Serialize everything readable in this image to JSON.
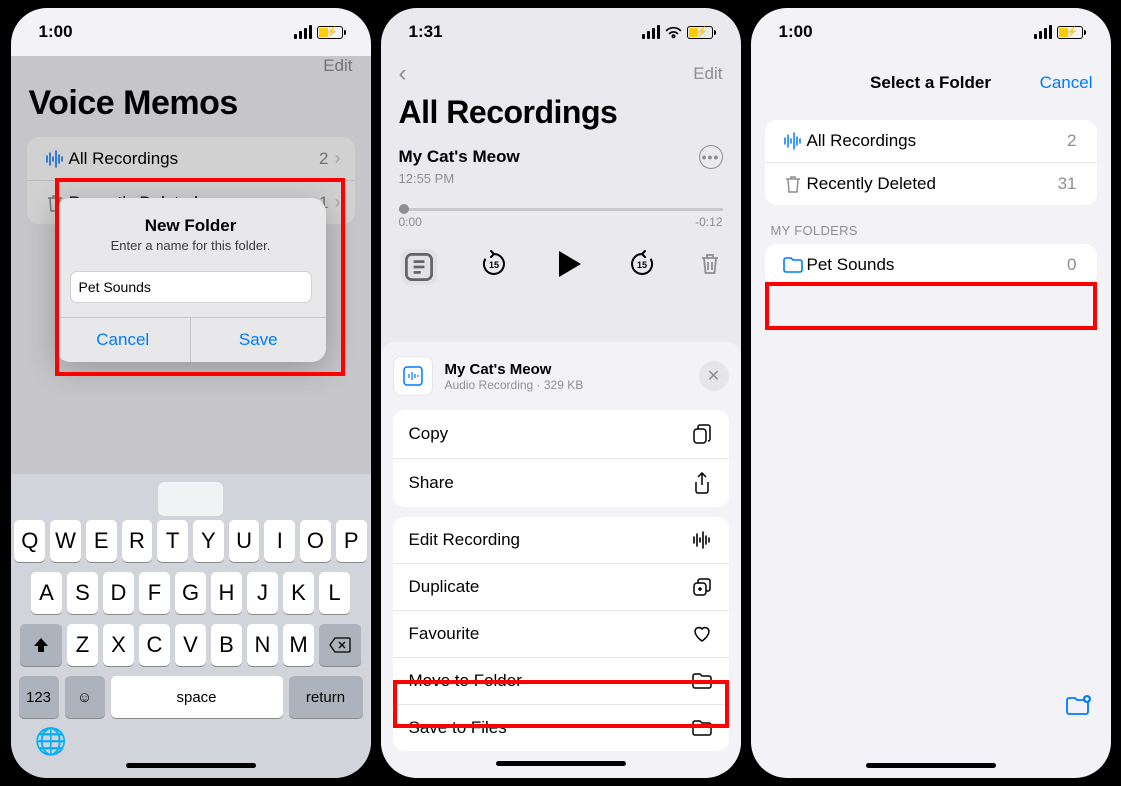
{
  "status": {
    "time1": "1:00",
    "time2": "1:31",
    "time3": "1:00"
  },
  "screen1": {
    "edit": "Edit",
    "title": "Voice Memos",
    "rows": [
      {
        "label": "All Recordings",
        "count": "2"
      },
      {
        "label": "Recently Deleted",
        "count": "1"
      }
    ],
    "alert": {
      "title": "New Folder",
      "message": "Enter a name for this folder.",
      "value": "Pet Sounds",
      "cancel": "Cancel",
      "save": "Save"
    },
    "keyboard": {
      "r1": [
        "Q",
        "W",
        "E",
        "R",
        "T",
        "Y",
        "U",
        "I",
        "O",
        "P"
      ],
      "r2": [
        "A",
        "S",
        "D",
        "F",
        "G",
        "H",
        "J",
        "K",
        "L"
      ],
      "r3": [
        "Z",
        "X",
        "C",
        "V",
        "B",
        "N",
        "M"
      ],
      "fn": "123",
      "space": "space",
      "ret": "return"
    }
  },
  "screen2": {
    "edit": "Edit",
    "title": "All Recordings",
    "rec": {
      "name": "My Cat's Meow",
      "time": "12:55 PM",
      "elapsed": "0:00",
      "remain": "-0:12"
    },
    "sheet": {
      "title": "My Cat's Meow",
      "sub": "Audio Recording · 329 KB",
      "copy": "Copy",
      "share": "Share",
      "editrec": "Edit Recording",
      "duplicate": "Duplicate",
      "favourite": "Favourite",
      "move": "Move to Folder",
      "savefiles": "Save to Files"
    }
  },
  "screen3": {
    "title": "Select a Folder",
    "cancel": "Cancel",
    "rows": [
      {
        "label": "All Recordings",
        "count": "2"
      },
      {
        "label": "Recently Deleted",
        "count": "31"
      }
    ],
    "section": "My Folders",
    "folder": {
      "label": "Pet Sounds",
      "count": "0"
    }
  }
}
